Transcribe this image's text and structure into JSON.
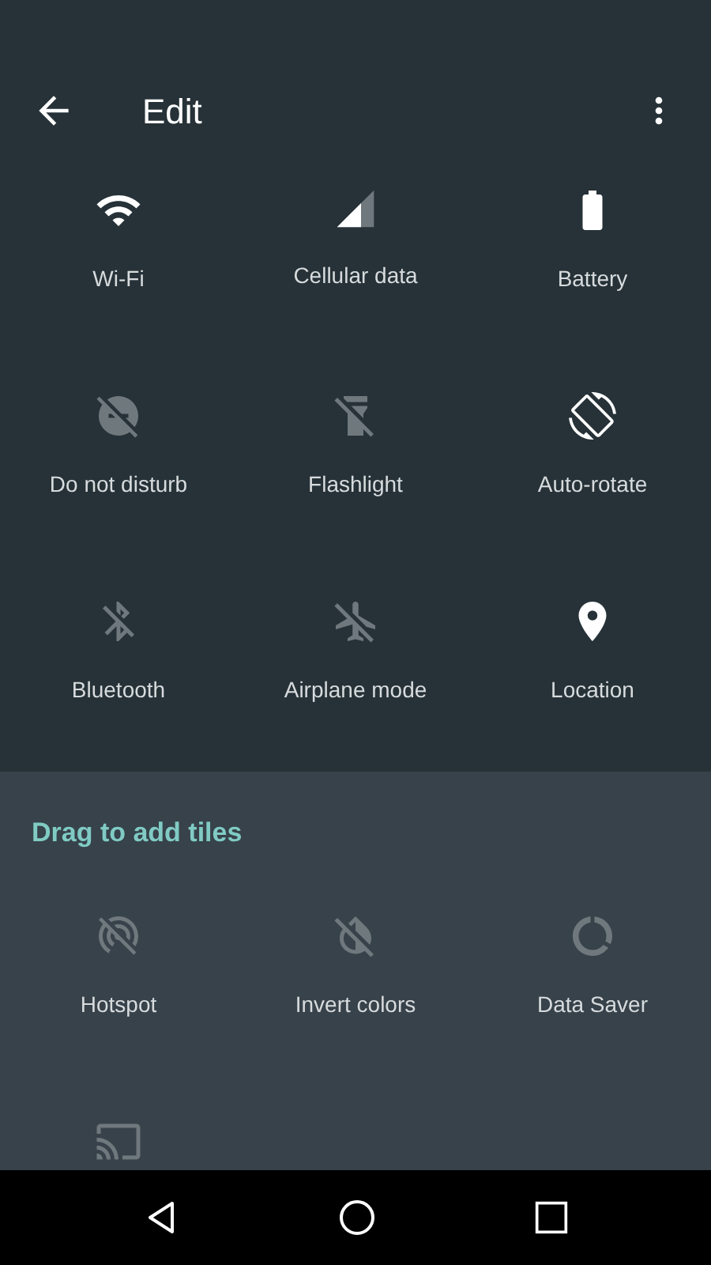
{
  "app_bar": {
    "title": "Edit"
  },
  "active_tiles": [
    {
      "kind": "wifi",
      "label": "Wi-Fi",
      "on": true
    },
    {
      "kind": "cellular",
      "label": "Cellular data",
      "on": true
    },
    {
      "kind": "battery",
      "label": "Battery",
      "on": true
    },
    {
      "kind": "dnd",
      "label": "Do not disturb",
      "on": false
    },
    {
      "kind": "flashlight",
      "label": "Flashlight",
      "on": false
    },
    {
      "kind": "rotate",
      "label": "Auto-rotate",
      "on": true
    },
    {
      "kind": "bluetooth",
      "label": "Bluetooth",
      "on": false
    },
    {
      "kind": "airplane",
      "label": "Airplane mode",
      "on": false
    },
    {
      "kind": "location",
      "label": "Location",
      "on": true
    }
  ],
  "add_section": {
    "title": "Drag to add tiles"
  },
  "available_tiles": [
    {
      "kind": "hotspot",
      "label": "Hotspot",
      "on": false
    },
    {
      "kind": "invert",
      "label": "Invert colors",
      "on": false
    },
    {
      "kind": "datasaver",
      "label": "Data Saver",
      "on": false
    },
    {
      "kind": "cast",
      "on": false
    }
  ]
}
